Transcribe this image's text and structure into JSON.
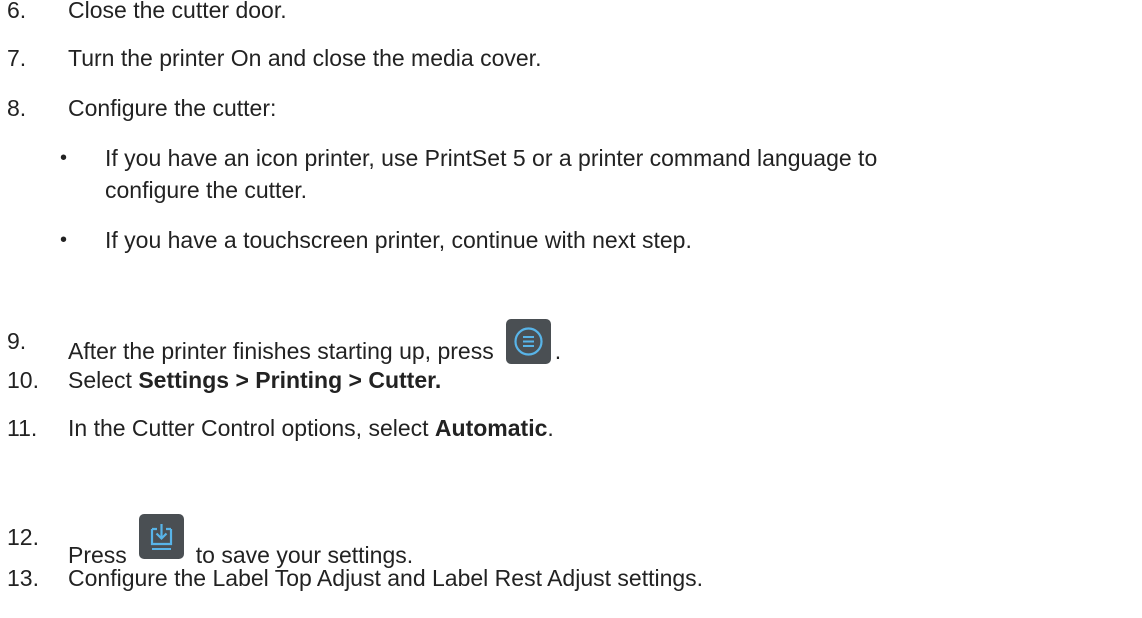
{
  "steps": {
    "s6": {
      "num": "6.",
      "text": "Close the cutter door."
    },
    "s7": {
      "num": "7.",
      "text": "Turn the printer On and close the media cover."
    },
    "s8": {
      "num": "8.",
      "text": "Configure the cutter:"
    },
    "b1": {
      "line1": "If you have an icon printer, use PrintSet 5 or a printer command language to",
      "line2": "configure the cutter."
    },
    "b2": {
      "text": "If you have a touchscreen printer, continue with next step."
    },
    "s9": {
      "num": "9.",
      "before": "After the printer finishes starting up, press",
      "after": "."
    },
    "s10": {
      "num": "10.",
      "before": "Select ",
      "bold": "Settings > Printing > Cutter."
    },
    "s11": {
      "num": "11.",
      "before": "In the Cutter Control options, select ",
      "bold": "Automatic",
      "after": "."
    },
    "s12": {
      "num": "12.",
      "before": "Press",
      "after": "to save your settings."
    },
    "s13": {
      "num": "13.",
      "text": "Configure the Label Top Adjust and Label Rest Adjust settings."
    }
  },
  "bullet_char": "•",
  "icons": {
    "menu": "menu-icon",
    "save": "save-icon"
  },
  "colors": {
    "text": "#222222",
    "icon_bg": "#4a4f53",
    "icon_accent": "#58b4e8"
  }
}
